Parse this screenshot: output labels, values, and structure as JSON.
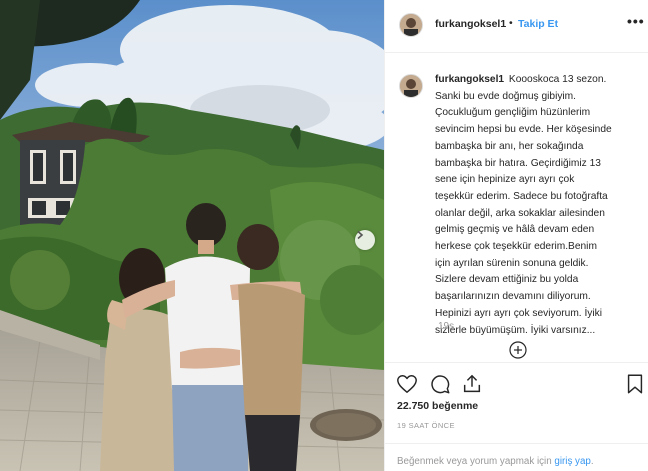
{
  "post": {
    "username": "furkangoksel1",
    "dot": "•",
    "follow_label": "Takip Et",
    "more_label": "•••",
    "caption_lines": [
      "Koooskoca 13 sezon.",
      "Sanki bu evde doğmuş gibiyim.",
      "Çocukluğum gençliğim hüzünlerim",
      "sevincim hepsi bu evde. Her köşesinde",
      "bambaşka bir anı, her sokağında",
      "bambaşka bir hatıra. Geçirdiğimiz 13",
      "sene için hepinize ayrı ayrı çok",
      "teşekkür ederim. Sadece bu fotoğrafta",
      "olanlar değil, arka sokaklar ailesinden",
      "gelmiş geçmiş ve hâlâ devam eden",
      "herkese çok teşekkür ederim.Benim",
      "için ayrılan sürenin sonuna geldik.",
      "Sizlere devam ettiğiniz bu yolda",
      "başarılarınızın devamını diliyorum.",
      "Hepinizi ayrı ayrı çok seviyorum. İyiki",
      "sizlerle büyümüşüm. İyiki varsınız..."
    ],
    "time_ago": "19s",
    "likes": "22.750 beğenme",
    "post_time": "19 SAAT ÖNCE",
    "login_prompt": "Beğenmek veya yorum yapmak için",
    "login_link": "giriş yap",
    "login_suffix": "."
  },
  "icons": {
    "avatar": "avatar-photo",
    "next": "chevron-right-icon",
    "add_comment": "plus-circle-icon",
    "like": "heart-icon",
    "comment": "comment-bubble-icon",
    "share": "share-icon",
    "save": "bookmark-icon"
  },
  "colors": {
    "link_blue": "#3897f0",
    "muted": "#999999",
    "text": "#262626",
    "border": "#efefef"
  }
}
